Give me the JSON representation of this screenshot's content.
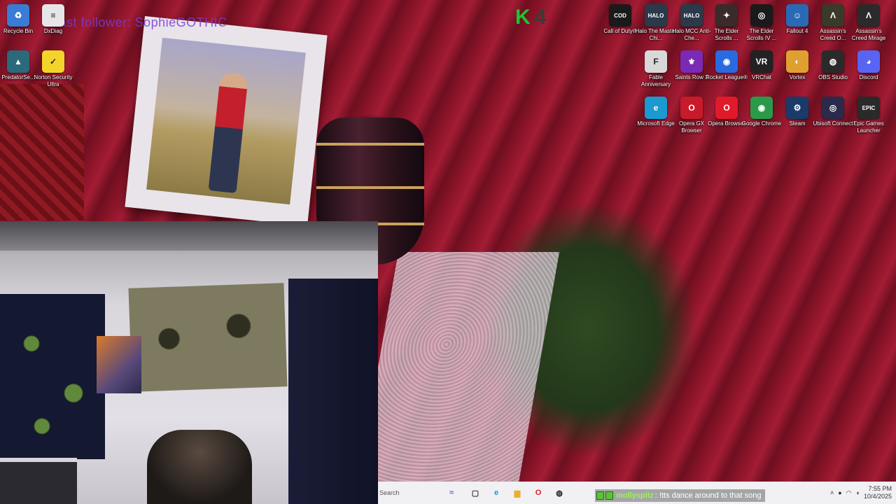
{
  "overlay": {
    "title_text": "Last follower: SophieGOTHIC",
    "badge_letter": "K",
    "badge_number": "4"
  },
  "desktop_icons": [
    {
      "label": "Recycle Bin",
      "icon": "recycle-bin-icon",
      "color": "#3a7bd5"
    },
    {
      "label": "DxDiag",
      "icon": "document-icon",
      "color": "#e6e6e6"
    },
    {
      "label": "PredatorSe...",
      "icon": "predator-sense-icon",
      "color": "#2a6a7a"
    },
    {
      "label": "Norton Security Ultra",
      "icon": "norton-icon",
      "color": "#f3d42a"
    },
    {
      "label": "Call of Duty®",
      "icon": "call-of-duty-icon",
      "color": "#1a1a1a"
    },
    {
      "label": "Halo The Master Chi...",
      "icon": "halo-icon",
      "color": "#2a3a4a"
    },
    {
      "label": "Halo MCC Anti-Che...",
      "icon": "halo-mcc-icon",
      "color": "#2a3a4a"
    },
    {
      "label": "The Elder Scrolls ...",
      "icon": "elder-scrolls-icon",
      "color": "#3a2a2a"
    },
    {
      "label": "The Elder Scrolls IV ...",
      "icon": "oblivion-icon",
      "color": "#1a1a1a"
    },
    {
      "label": "Fallout 4",
      "icon": "fallout-icon",
      "color": "#2a6ab5"
    },
    {
      "label": "Assassin's Creed O...",
      "icon": "assassins-creed-icon",
      "color": "#3a3a2a"
    },
    {
      "label": "Assassin's Creed Mirage",
      "icon": "assassins-creed-mirage-icon",
      "color": "#2a2a2a"
    },
    {
      "label": "Fable Anniversary",
      "icon": "fable-icon",
      "color": "#d8d8d8"
    },
    {
      "label": "Saints Row 2",
      "icon": "saints-row-icon",
      "color": "#7a2ab5"
    },
    {
      "label": "Rocket League®",
      "icon": "rocket-league-icon",
      "color": "#2a6ae0"
    },
    {
      "label": "VRChat",
      "icon": "vrchat-icon",
      "color": "#222222"
    },
    {
      "label": "Vortex",
      "icon": "vortex-icon",
      "color": "#e0a030"
    },
    {
      "label": "OBS Studio",
      "icon": "obs-icon",
      "color": "#2a2a2a"
    },
    {
      "label": "Discord",
      "icon": "discord-icon",
      "color": "#5865f2"
    },
    {
      "label": "Microsoft Edge",
      "icon": "edge-icon",
      "color": "#1a9ad0"
    },
    {
      "label": "Opera GX Browser",
      "icon": "opera-gx-icon",
      "color": "#c81a2a"
    },
    {
      "label": "Opera Browser",
      "icon": "opera-icon",
      "color": "#e01a2a"
    },
    {
      "label": "Google Chrome",
      "icon": "chrome-icon",
      "color": "#2a9a4a"
    },
    {
      "label": "Steam",
      "icon": "steam-icon",
      "color": "#1a3a6a"
    },
    {
      "label": "Ubisoft Connect",
      "icon": "ubisoft-icon",
      "color": "#2a2a4a"
    },
    {
      "label": "Epic Games Launcher",
      "icon": "epic-games-icon",
      "color": "#2a2a2a"
    }
  ],
  "icon_glyphs": {
    "recycle-bin-icon": "♻",
    "document-icon": "≡",
    "predator-sense-icon": "▲",
    "norton-icon": "✓",
    "call-of-duty-icon": "COD",
    "halo-icon": "HALO",
    "halo-mcc-icon": "HALO",
    "elder-scrolls-icon": "✦",
    "oblivion-icon": "◎",
    "fallout-icon": "☺",
    "assassins-creed-icon": "Λ",
    "assassins-creed-mirage-icon": "Λ",
    "fable-icon": "F",
    "saints-row-icon": "⚜",
    "rocket-league-icon": "◉",
    "vrchat-icon": "VR",
    "vortex-icon": "◐",
    "obs-icon": "◍",
    "discord-icon": "◕",
    "edge-icon": "e",
    "opera-gx-icon": "O",
    "opera-icon": "O",
    "chrome-icon": "◉",
    "steam-icon": "⚙",
    "ubisoft-icon": "◎",
    "epic-games-icon": "EPIC"
  },
  "taskbar": {
    "search_placeholder": "Search",
    "pinned": [
      {
        "name": "task-view-icon",
        "glyph": "▢",
        "color": "#333333"
      },
      {
        "name": "edge-taskbar-icon",
        "glyph": "e",
        "color": "#1a9ad0"
      },
      {
        "name": "file-explorer-icon",
        "glyph": "▆",
        "color": "#e8b030"
      },
      {
        "name": "opera-taskbar-icon",
        "glyph": "O",
        "color": "#e01a2a"
      },
      {
        "name": "obs-taskbar-icon",
        "glyph": "◍",
        "color": "#222222"
      }
    ],
    "clock_time": "7:55 PM",
    "clock_date": "10/4/2025"
  },
  "chat": {
    "username": "mollyspitz",
    "message": ": !tts dance around to that song"
  }
}
